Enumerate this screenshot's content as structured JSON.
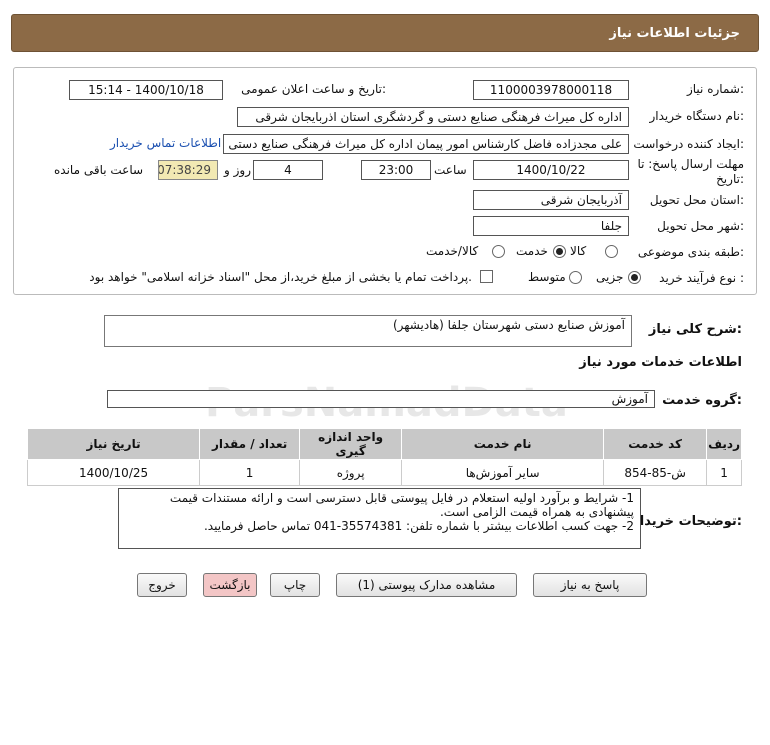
{
  "header": {
    "title": "جزئیات اطلاعات نیاز"
  },
  "need": {
    "number_label": "شماره نیاز:",
    "number": "1100003978000118",
    "announce_label": "تاریخ و ساعت اعلان عمومی:",
    "announce": "1400/10/18 - 15:14",
    "buyer_label": "نام دستگاه خریدار:",
    "buyer": "اداره کل میراث فرهنگی  صنایع دستی و گردشگری استان اذربایجان شرقی",
    "creator_label": "ایجاد کننده درخواست:",
    "creator": "علی مجدزاده فاضل کارشناس امور پیمان اداره کل میراث فرهنگی  صنایع دستی",
    "contact_link": "اطلاعات تماس خریدار",
    "deadline_label": "مهلت ارسال پاسخ: تا تاریخ:",
    "deadline_date": "1400/10/22",
    "time_label": "ساعت",
    "deadline_time": "23:00",
    "days": "4",
    "days_label": "روز و",
    "remaining": "07:38:29",
    "remaining_label": "ساعت باقی مانده",
    "province_label": "استان محل تحویل:",
    "province": "آذربایجان شرقی",
    "city_label": "شهر محل تحویل:",
    "city": "جلفا",
    "category_label": "طبقه بندی موضوعی:",
    "category_options": [
      "کالا",
      "خدمت",
      "کالا/خدمت"
    ],
    "process_label": "نوع فرآیند خرید :",
    "process_options": [
      "جزیی",
      "متوسط"
    ],
    "payment_text": "پرداخت تمام یا بخشی از مبلغ خرید،از محل \"اسناد خزانه اسلامی\" خواهد بود."
  },
  "summary": {
    "label": "شرح کلی نیاز:",
    "value": "آموزش صنایع دستی شهرستان جلفا (هادیشهر)"
  },
  "services": {
    "section_title": "اطلاعات خدمات مورد نیاز",
    "group_label": "گروه خدمت:",
    "group_value": "آموزش",
    "columns": [
      "ردیف",
      "کد خدمت",
      "نام خدمت",
      "واحد اندازه گیری",
      "تعداد / مقدار",
      "تاریخ نیاز"
    ],
    "rows": [
      [
        "1",
        "ش-85-854",
        "سایر آموزش‌ها",
        "پروژه",
        "1",
        "1400/10/25"
      ]
    ]
  },
  "notes": {
    "label": "توضیحات خریدار:",
    "line1": "1- شرایط و برآورد اولیه استعلام در فایل پیوستی قابل دسترسی است و ارائه مستندات قیمت",
    "line2": "پیشنهادی به همراه قیمت الزامی است.",
    "line3": "2- جهت کسب اطلاعات بیشتر  با شماره تلفن: 35574381-041  تماس حاصل فرمایید."
  },
  "buttons": {
    "reply": "پاسخ به نیاز",
    "attachments": "مشاهده مدارک پیوستی (1)",
    "print": "چاپ",
    "back": "بازگشت",
    "exit": "خروج"
  },
  "watermark": {
    "brand": "ParsNamadData"
  }
}
